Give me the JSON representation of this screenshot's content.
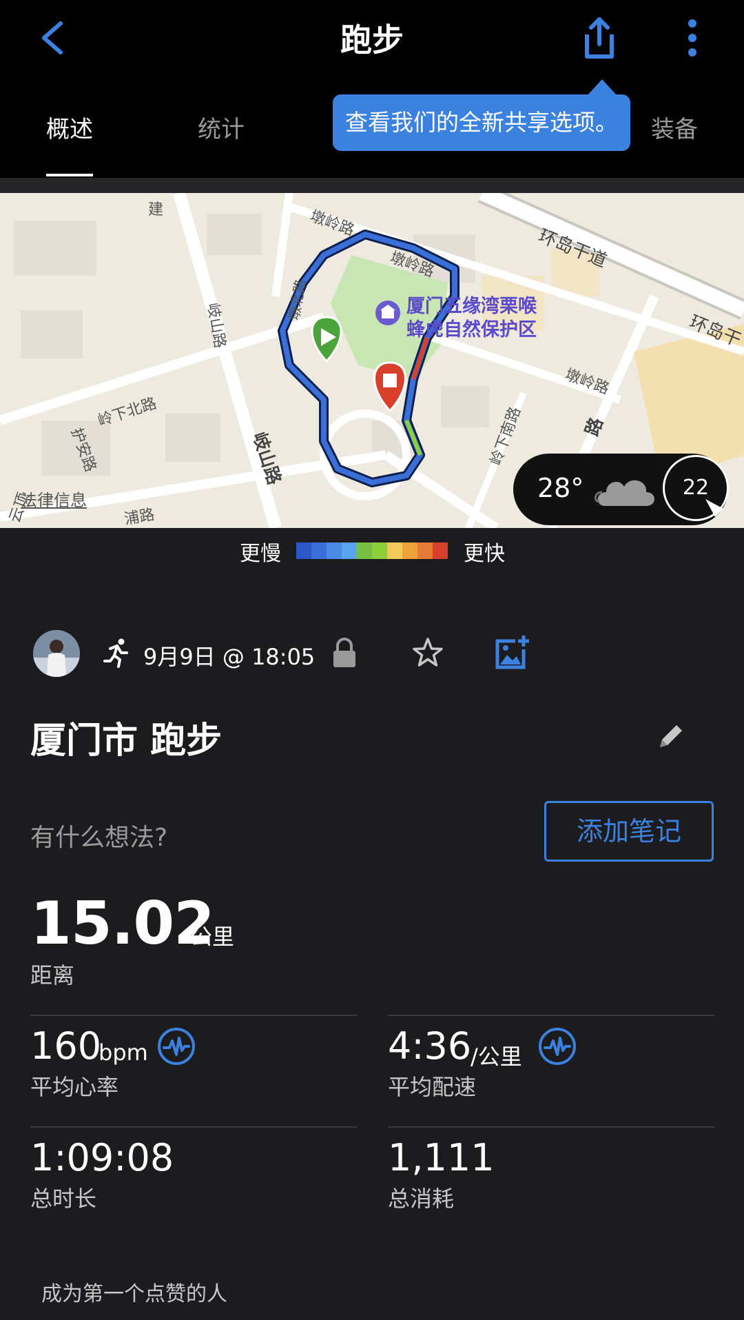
{
  "header": {
    "title": "跑步",
    "tabs": [
      "概述",
      "统计",
      "装备"
    ],
    "active_tab": "概述",
    "tooltip": "查看我们的全新共享选项。"
  },
  "map": {
    "labels": {
      "poi": "厦门五缘湾栗喉",
      "poi2": "蜂虎自然保护区",
      "road1": "环岛干道",
      "road1b": "环岛干",
      "road2": "墩岭路",
      "road2b": "墩岭路",
      "road2c": "墩岭路",
      "road3": "岐山路",
      "road3b": "岐山路",
      "road4": "岭下北路",
      "road5": "护安路",
      "road6": "岭下南路",
      "road7": "墩北路",
      "road8": "建",
      "road9": "云顶",
      "road10": "路",
      "road11": "浦路"
    },
    "legal_link": "法律信息",
    "weather": {
      "temp": "28°",
      "icon": "cloud-icon",
      "wind": "22"
    }
  },
  "speed_legend": {
    "slower": "更慢",
    "faster": "更快",
    "colors": [
      "#2d57c8",
      "#3a6fd8",
      "#4a8ae6",
      "#5aa3ee",
      "#77c043",
      "#8ccf3a",
      "#f2c95c",
      "#f0a23a",
      "#e67b35",
      "#d8402c"
    ]
  },
  "activity": {
    "datetime": "9月9日 @ 18:05",
    "name": "厦门市 跑步",
    "thought_prompt": "有什么想法?",
    "add_note": "添加笔记"
  },
  "stats": {
    "distance": {
      "value": "15.02",
      "unit": "公里",
      "label": "距离"
    },
    "heart_rate": {
      "value": "160",
      "unit": "bpm",
      "label": "平均心率"
    },
    "pace": {
      "value": "4:36",
      "unit": "/公里",
      "label": "平均配速"
    },
    "duration": {
      "value": "1:09:08",
      "label": "总时长"
    },
    "calories": {
      "value": "1,111",
      "label": "总消耗"
    }
  },
  "social": {
    "likes_prompt": "成为第一个点赞的人"
  },
  "colors": {
    "accent": "#3b82e0",
    "background": "#1c1c1e",
    "header": "#000000"
  }
}
